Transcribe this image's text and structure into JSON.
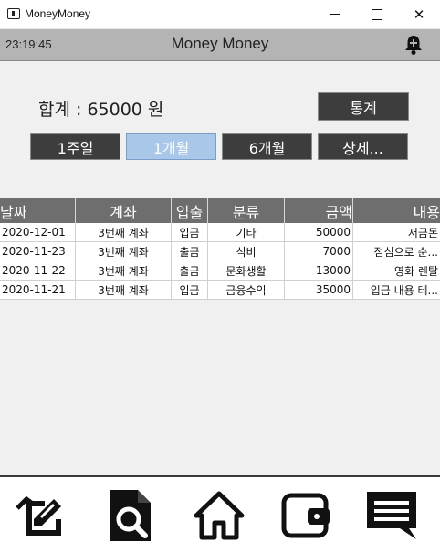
{
  "window": {
    "title": "MoneyMoney",
    "minimize": "—",
    "maximize": "☐",
    "close": "✕"
  },
  "header": {
    "clock": "23:19:45",
    "title": "Money Money",
    "bell_icon": "bell-plus-icon"
  },
  "summary": {
    "total_label": "합계 : 65000 원",
    "stats_button": "통계"
  },
  "periods": [
    {
      "label": "1주일",
      "active": false
    },
    {
      "label": "1개월",
      "active": true
    },
    {
      "label": "6개월",
      "active": false
    },
    {
      "label": "상세...",
      "active": false
    }
  ],
  "table": {
    "headers": [
      "날짜",
      "계좌",
      "입출",
      "분류",
      "금액",
      "내용"
    ],
    "rows": [
      [
        "2020-12-01",
        "3번째 계좌",
        "입금",
        "기타",
        "50000",
        "저금돈"
      ],
      [
        "2020-11-23",
        "3번째 계좌",
        "출금",
        "식비",
        "7000",
        "점심으로 순..."
      ],
      [
        "2020-11-22",
        "3번째 계좌",
        "출금",
        "문화생활",
        "13000",
        "영화 렌탈"
      ],
      [
        "2020-11-21",
        "3번째 계좌",
        "입금",
        "금융수익",
        "35000",
        "입금 내용 테..."
      ]
    ]
  },
  "colors": {
    "header_bg": "#b4b4b4",
    "button_bg": "#3d3d3d",
    "active_bg": "#a9c7e8",
    "table_head": "#6e6e6e"
  },
  "nav": [
    "document-edit-icon",
    "document-search-icon",
    "home-icon",
    "wallet-icon",
    "chat-message-icon"
  ]
}
